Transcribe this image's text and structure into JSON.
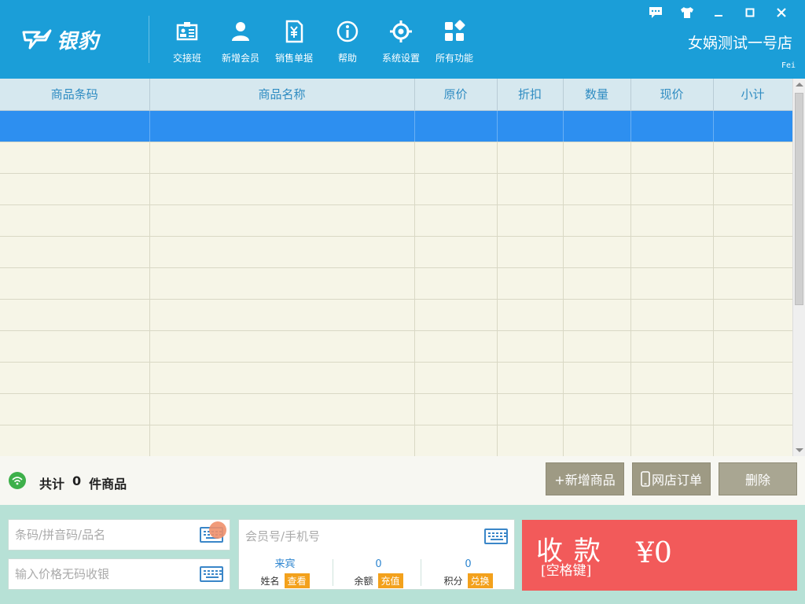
{
  "header": {
    "brand": "银豹",
    "store_name": "女娲测试一号店",
    "user": "Fei",
    "toolbar": [
      {
        "label": "交接班",
        "icon": "shift-handover-icon"
      },
      {
        "label": "新增会员",
        "icon": "add-member-icon"
      },
      {
        "label": "销售单据",
        "icon": "sales-receipt-icon"
      },
      {
        "label": "帮助",
        "icon": "help-icon"
      },
      {
        "label": "系统设置",
        "icon": "settings-icon"
      },
      {
        "label": "所有功能",
        "icon": "all-functions-icon"
      }
    ]
  },
  "grid": {
    "columns": [
      "商品条码",
      "商品名称",
      "原价",
      "折扣",
      "数量",
      "现价",
      "小计"
    ],
    "rows": []
  },
  "summary": {
    "prefix": "共计",
    "count": "0",
    "suffix": "件商品",
    "add_goods": "+新增商品",
    "online_orders": "网店订单",
    "delete": "删除"
  },
  "inputs": {
    "barcode_placeholder": "条码/拼音码/品名",
    "price_placeholder": "输入价格无码收银",
    "member_placeholder": "会员号/手机号"
  },
  "member": {
    "name_value": "来宾",
    "name_label": "姓名",
    "view_btn": "查看",
    "balance_value": "0",
    "balance_label": "余额",
    "recharge_btn": "充值",
    "points_value": "0",
    "points_label": "积分",
    "exchange_btn": "兑换"
  },
  "checkout": {
    "title": "收款",
    "hotkey": "[空格键]",
    "amount": "¥0"
  },
  "colors": {
    "header_bg": "#1b9ed8",
    "selected_row": "#2d8ff0",
    "pay_bg": "#f25a5a",
    "orange_btn": "#f3a11c"
  }
}
